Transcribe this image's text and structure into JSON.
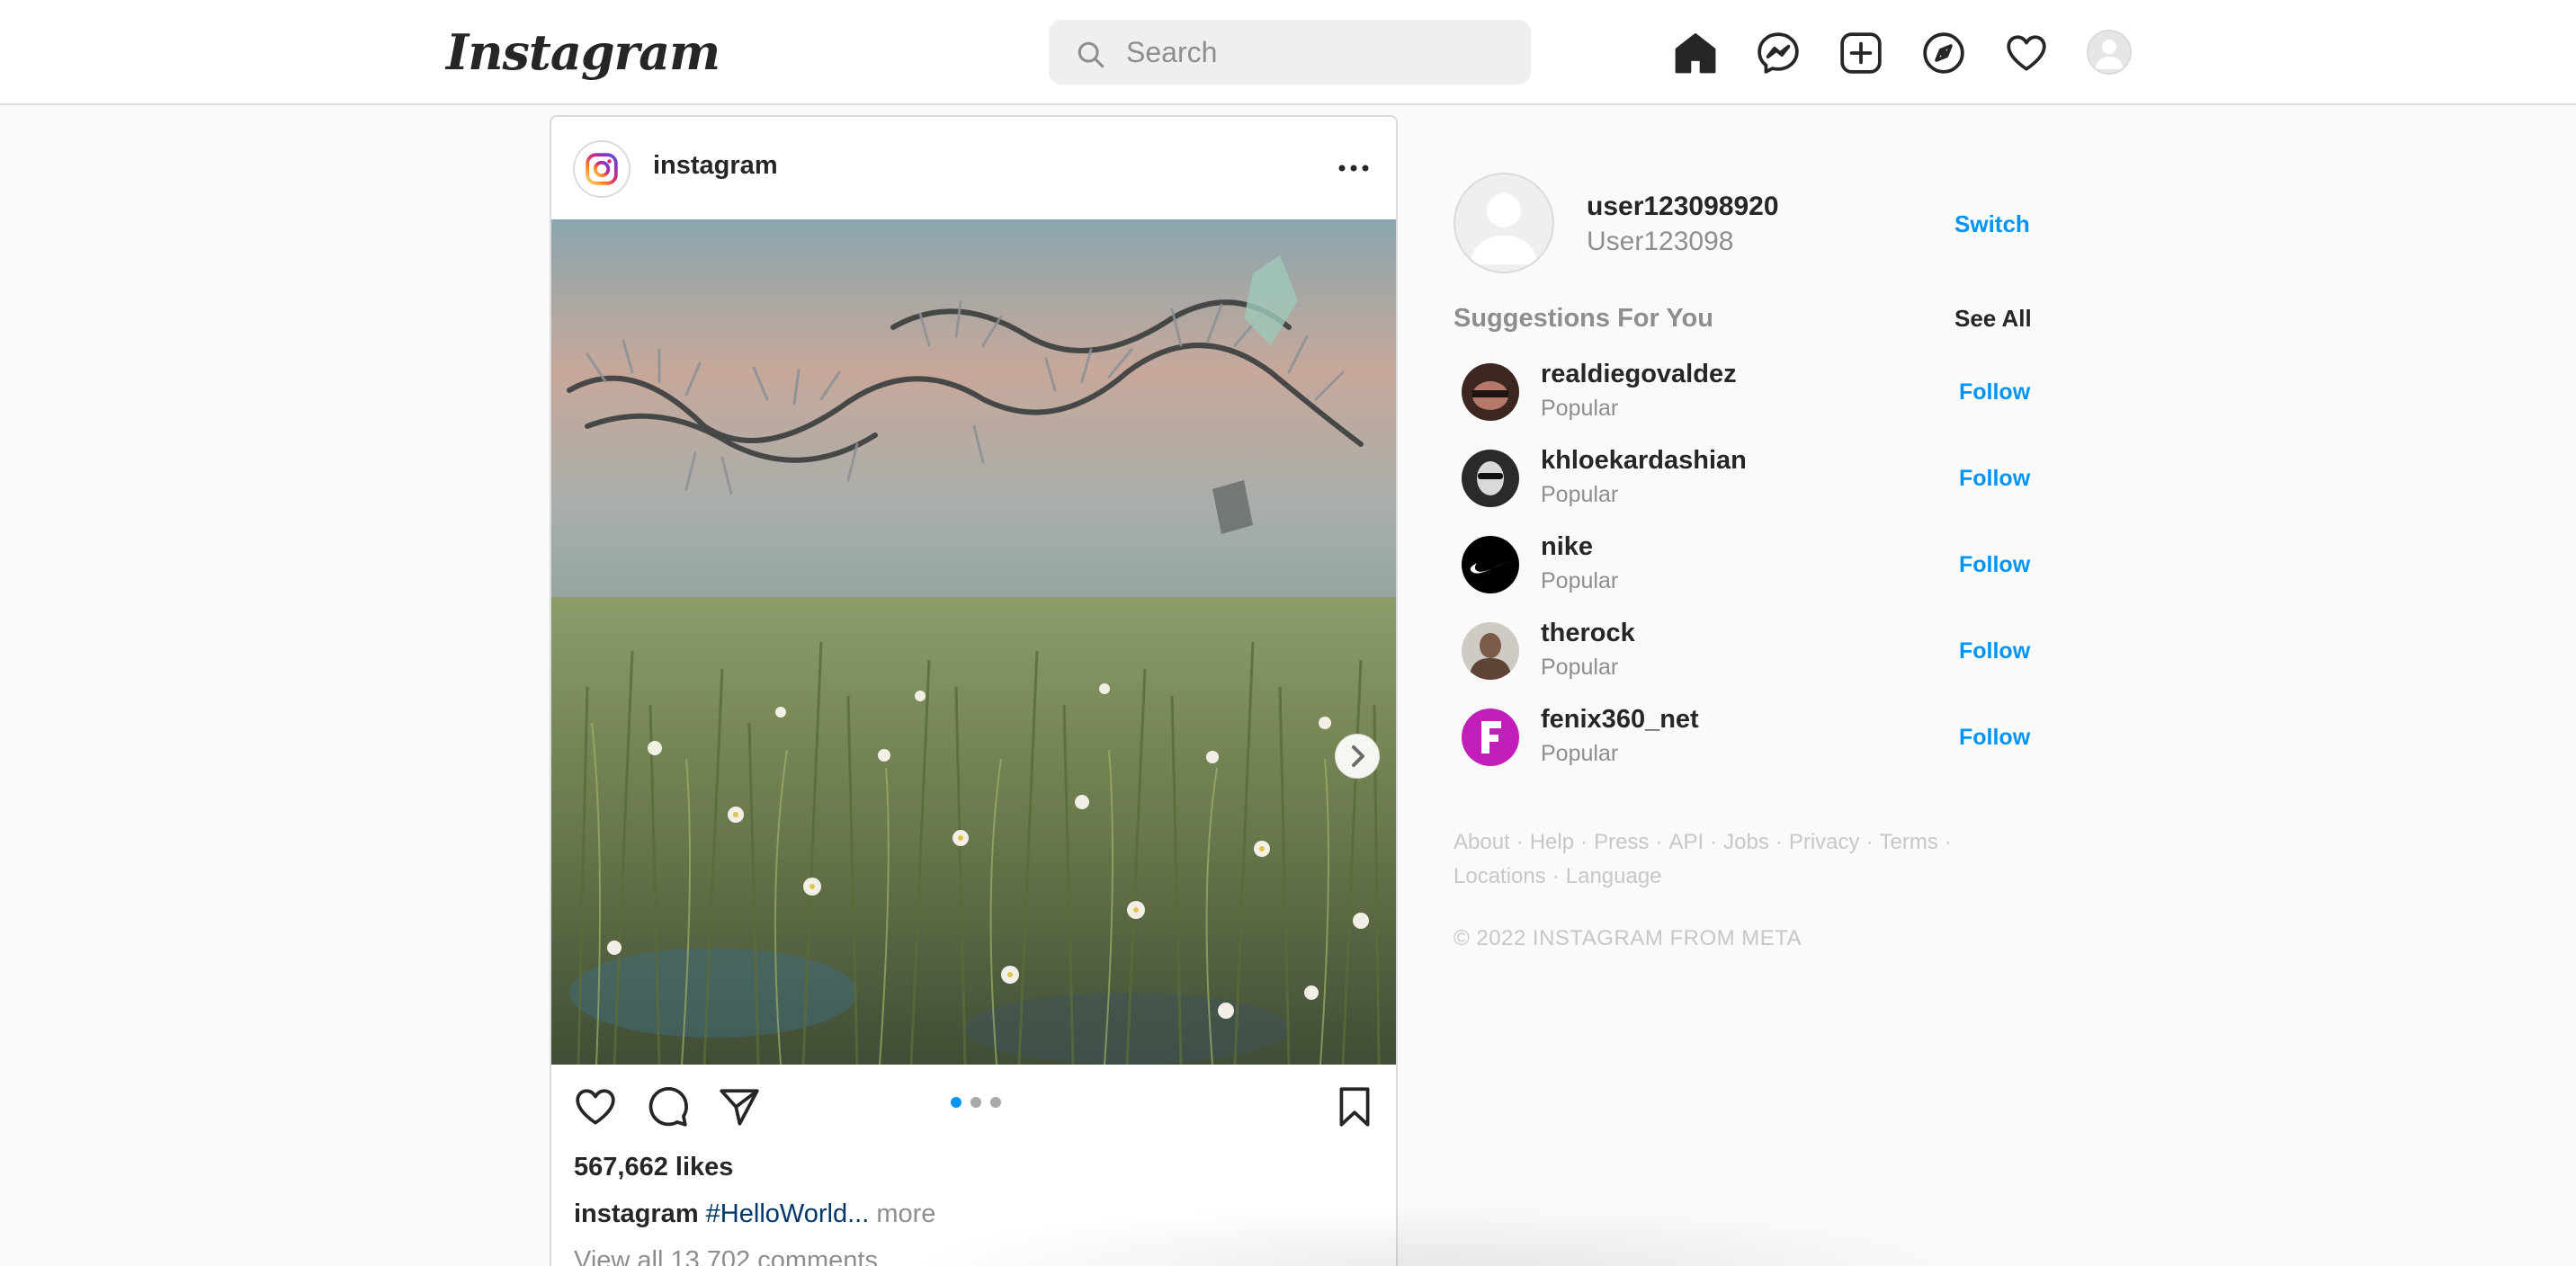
{
  "header": {
    "logo_text": "Instagram",
    "search": {
      "placeholder": "Search"
    }
  },
  "post": {
    "username": "instagram",
    "image_carousel": {
      "current_slide": 1,
      "total_slides": 3
    },
    "likes": "567,662 likes",
    "caption": {
      "username": "instagram",
      "hashtag": "#HelloWorld...",
      "more_label": "more"
    },
    "view_comments": "View all 13,702 comments"
  },
  "sidebar": {
    "current_user": {
      "username": "user123098920",
      "full_name": "User123098",
      "switch_label": "Switch"
    },
    "suggestions_title": "Suggestions For You",
    "see_all_label": "See All",
    "suggestions": [
      {
        "username": "realdiegovaldez",
        "subtitle": "Popular",
        "follow_label": "Follow"
      },
      {
        "username": "khloekardashian",
        "subtitle": "Popular",
        "follow_label": "Follow"
      },
      {
        "username": "nike",
        "subtitle": "Popular",
        "follow_label": "Follow"
      },
      {
        "username": "therock",
        "subtitle": "Popular",
        "follow_label": "Follow"
      },
      {
        "username": "fenix360_net",
        "subtitle": "Popular",
        "follow_label": "Follow"
      }
    ],
    "footer_links": [
      "About",
      "Help",
      "Press",
      "API",
      "Jobs",
      "Privacy",
      "Terms",
      "Locations",
      "Language"
    ],
    "copyright": "© 2022 INSTAGRAM FROM META"
  },
  "colors": {
    "accent": "#0095f6",
    "text_primary": "#262626",
    "text_secondary": "#8e8e8e",
    "border": "#dbdbdb",
    "background": "#fafafa",
    "hashtag": "#00376b"
  },
  "icons": [
    "search-icon",
    "home-icon",
    "messenger-icon",
    "new-post-icon",
    "explore-icon",
    "activity-heart-icon",
    "like-icon",
    "comment-icon",
    "share-icon",
    "save-icon",
    "more-options-icon",
    "chevron-right-icon"
  ]
}
